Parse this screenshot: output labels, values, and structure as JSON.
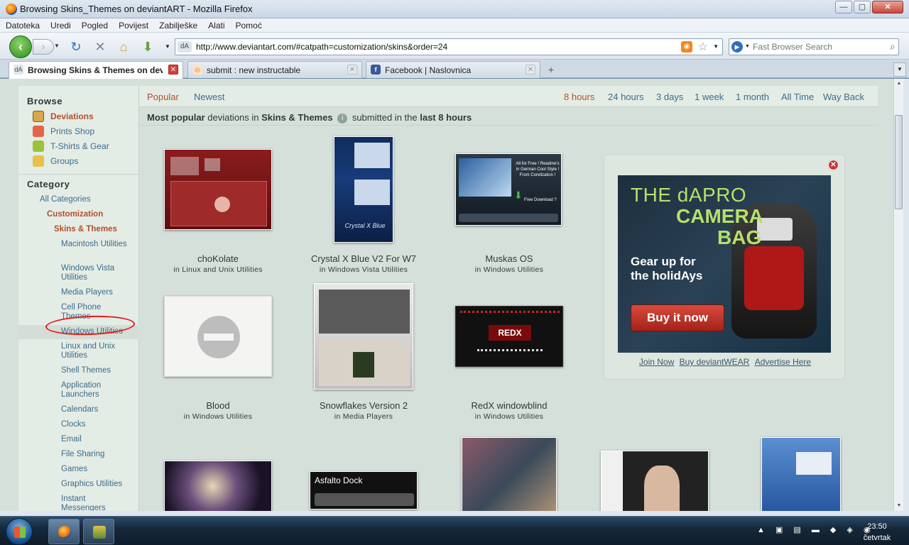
{
  "window": {
    "title": "Browsing Skins_Themes on deviantART - Mozilla Firefox",
    "min": "—",
    "max": "▢",
    "close": "✕"
  },
  "menu": [
    "Datoteka",
    "Uredi",
    "Pogled",
    "Povijest",
    "Zabilješke",
    "Alati",
    "Pomoć"
  ],
  "nav": {
    "url": "http://www.deviantart.com/#catpath=customization/skins&order=24",
    "search_placeholder": "Fast Browser Search"
  },
  "tabs": [
    {
      "label": "Browsing Skins & Themes on devia...",
      "active": true
    },
    {
      "label": "submit : new instructable",
      "active": false
    },
    {
      "label": "Facebook | Naslovnica",
      "active": false
    }
  ],
  "sidebar": {
    "browse_heading": "Browse",
    "browse_items": [
      "Deviations",
      "Prints Shop",
      "T-Shirts & Gear",
      "Groups"
    ],
    "category_heading": "Category",
    "all_categories": "All Categories",
    "customization": "Customization",
    "skins_themes": "Skins & Themes",
    "subcategories": [
      "Macintosh Utilities",
      "Windows Vista Utilities",
      "Media Players",
      "Cell Phone Themes",
      "Windows Utilities",
      "Linux and Unix Utilities",
      "Shell Themes",
      "Application Launchers",
      "Calendars",
      "Clocks",
      "Email",
      "File Sharing",
      "Games",
      "Graphics Utilities",
      "Instant Messengers"
    ]
  },
  "topnav": {
    "popular": "Popular",
    "newest": "Newest",
    "times": [
      "8 hours",
      "24 hours",
      "3 days",
      "1 week",
      "1 month",
      "All Time",
      "Way Back"
    ]
  },
  "heading": {
    "most_popular": "Most popular",
    "deviations_in": "deviations in",
    "category": "Skins & Themes",
    "submitted_in": "submitted in the",
    "period": "last 8 hours"
  },
  "deviations": [
    {
      "title": "choKolate",
      "category": "in Linux and Unix Utilities"
    },
    {
      "title": "Crystal X Blue V2 For W7",
      "category": "in Windows Vista Utilities"
    },
    {
      "title": "Muskas OS",
      "category": "in Windows Utilities"
    },
    {
      "title": "Blood",
      "category": "in Windows Utilities"
    },
    {
      "title": "Snowflakes Version 2",
      "category": "in Media Players"
    },
    {
      "title": "RedX windowblind",
      "category": "in Windows Utilities"
    }
  ],
  "row3": {
    "asfalto": "Asfalto Dock"
  },
  "thumb_text": {
    "crystal": "Crystal X Blue",
    "muskas_lines": "All for Free ! Readme's in German Cool Style ! From Corelization !",
    "muskas_dl": "Free Download ?",
    "redx": "REDX"
  },
  "ad": {
    "line1": "THE dAPRO",
    "line2": "CAMERA",
    "line3": "BAG",
    "line4": "Gear up for the holidAys",
    "button": "Buy it now",
    "links": [
      "Join Now",
      "Buy deviantWEAR",
      "Advertise Here"
    ]
  },
  "taskbar": {
    "time": "23:50",
    "day": "četvrtak"
  },
  "colors": {
    "link": "#3c6d8a",
    "accent": "#b4502b",
    "page_bg": "#d6e0da"
  }
}
